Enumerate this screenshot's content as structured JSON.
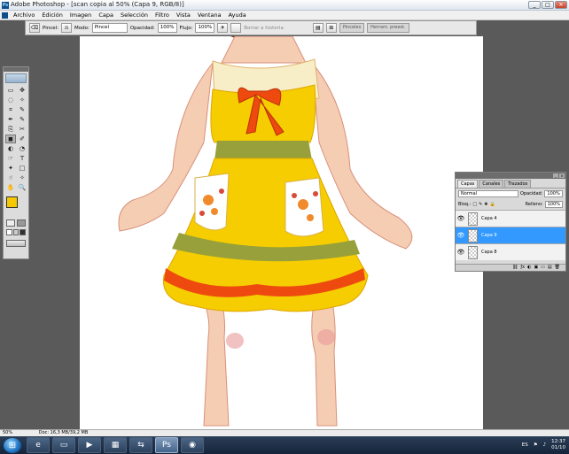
{
  "window": {
    "title": "Adobe Photoshop - [scan copia al 50% (Capa 9, RGB/8)]",
    "buttons": [
      "_",
      "□",
      "✕"
    ]
  },
  "menu": [
    "Archivo",
    "Edición",
    "Imagen",
    "Capa",
    "Selección",
    "Filtro",
    "Vista",
    "Ventana",
    "Ayuda"
  ],
  "options": {
    "brush_label": "Pincel:",
    "brush_size": "35",
    "mode_label": "Modo:",
    "mode_value": "Pincel",
    "opacity_label": "Opacidad:",
    "opacity_value": "100%",
    "flow_label": "Flujo:",
    "flow_value": "100%",
    "history_label": "Borrar a historia",
    "tabs": [
      "Pinceles",
      "Herram. preest."
    ]
  },
  "toolbox": {
    "tools": [
      "▭",
      "✥",
      "◌",
      "✧",
      "⌗",
      "✎",
      "✒",
      "✎",
      "⎘",
      "✂",
      "◼",
      "✐",
      "◐",
      "◔",
      "☞",
      "T",
      "✦",
      "□",
      "☝",
      "✧",
      "✋",
      "🔍"
    ]
  },
  "layers_panel": {
    "tabs": [
      "Capas",
      "Canales",
      "Trazados"
    ],
    "blend_mode": "Normal",
    "opacity_label": "Opacidad:",
    "opacity_value": "100%",
    "lock_label": "Bloq.:",
    "fill_label": "Relleno:",
    "fill_value": "100%",
    "layers": [
      {
        "name": "Capa 4",
        "selected": false
      },
      {
        "name": "Capa 9",
        "selected": true
      },
      {
        "name": "Capa 8",
        "selected": false
      }
    ],
    "footer_icons": [
      "⛓",
      "ƒx",
      "◐",
      "▣",
      "▭",
      "▤",
      "🗑"
    ]
  },
  "status": {
    "zoom": "50%",
    "doc_info": "Doc: 16,3 MB/39,2 MB"
  },
  "taskbar": {
    "apps": [
      "ie",
      "folder",
      "media",
      "photos",
      "network",
      "ps",
      "chrome"
    ],
    "lang": "ES",
    "time": "12:37",
    "date": "01/10"
  },
  "colors": {
    "dress_yellow": "#f5cd00",
    "dress_red": "#ee4a10",
    "dress_olive": "#97a03a",
    "skin": "#f4cdb3",
    "selection_blue": "#3399ff"
  }
}
